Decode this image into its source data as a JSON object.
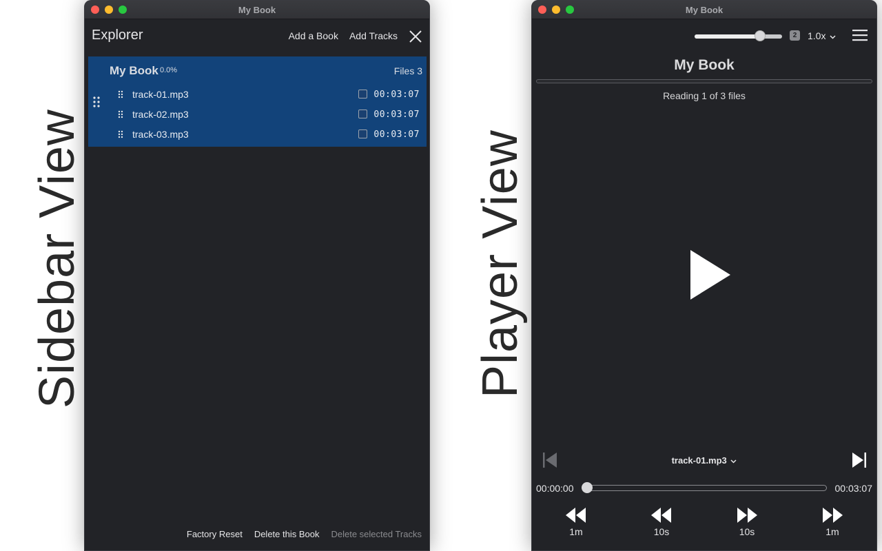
{
  "captions": {
    "sidebar": "Sidebar View",
    "player": "Player View"
  },
  "left_window": {
    "title": "My Book",
    "explorer": {
      "title": "Explorer",
      "add_book": "Add a Book",
      "add_tracks": "Add Tracks"
    },
    "book": {
      "name": "My Book",
      "progress": "0.0%",
      "files": "Files 3",
      "tracks": [
        {
          "name": "track-01.mp3",
          "duration": "00:03:07"
        },
        {
          "name": "track-02.mp3",
          "duration": "00:03:07"
        },
        {
          "name": "track-03.mp3",
          "duration": "00:03:07"
        }
      ]
    },
    "footer": {
      "factory_reset": "Factory Reset",
      "delete_book": "Delete this Book",
      "delete_tracks": "Delete selected Tracks"
    }
  },
  "right_window": {
    "title": "My Book",
    "volume_level": 0.75,
    "volume_badge": "2",
    "speed": "1.0x",
    "book_title": "My Book",
    "reading": "Reading 1 of 3 files",
    "current_track": "track-01.mp3",
    "time_current": "00:00:00",
    "time_total": "00:03:07",
    "skips": [
      {
        "label": "1m",
        "icon": "rewind-1m-icon"
      },
      {
        "label": "10s",
        "icon": "rewind-10s-icon"
      },
      {
        "label": "10s",
        "icon": "forward-10s-icon"
      },
      {
        "label": "1m",
        "icon": "forward-1m-icon"
      }
    ]
  },
  "colors": {
    "window_bg": "#222327",
    "book_selected_bg": "#12437a",
    "close_red": "#ff5f57",
    "minimize_yellow": "#febc2e",
    "zoom_green": "#28c840"
  }
}
